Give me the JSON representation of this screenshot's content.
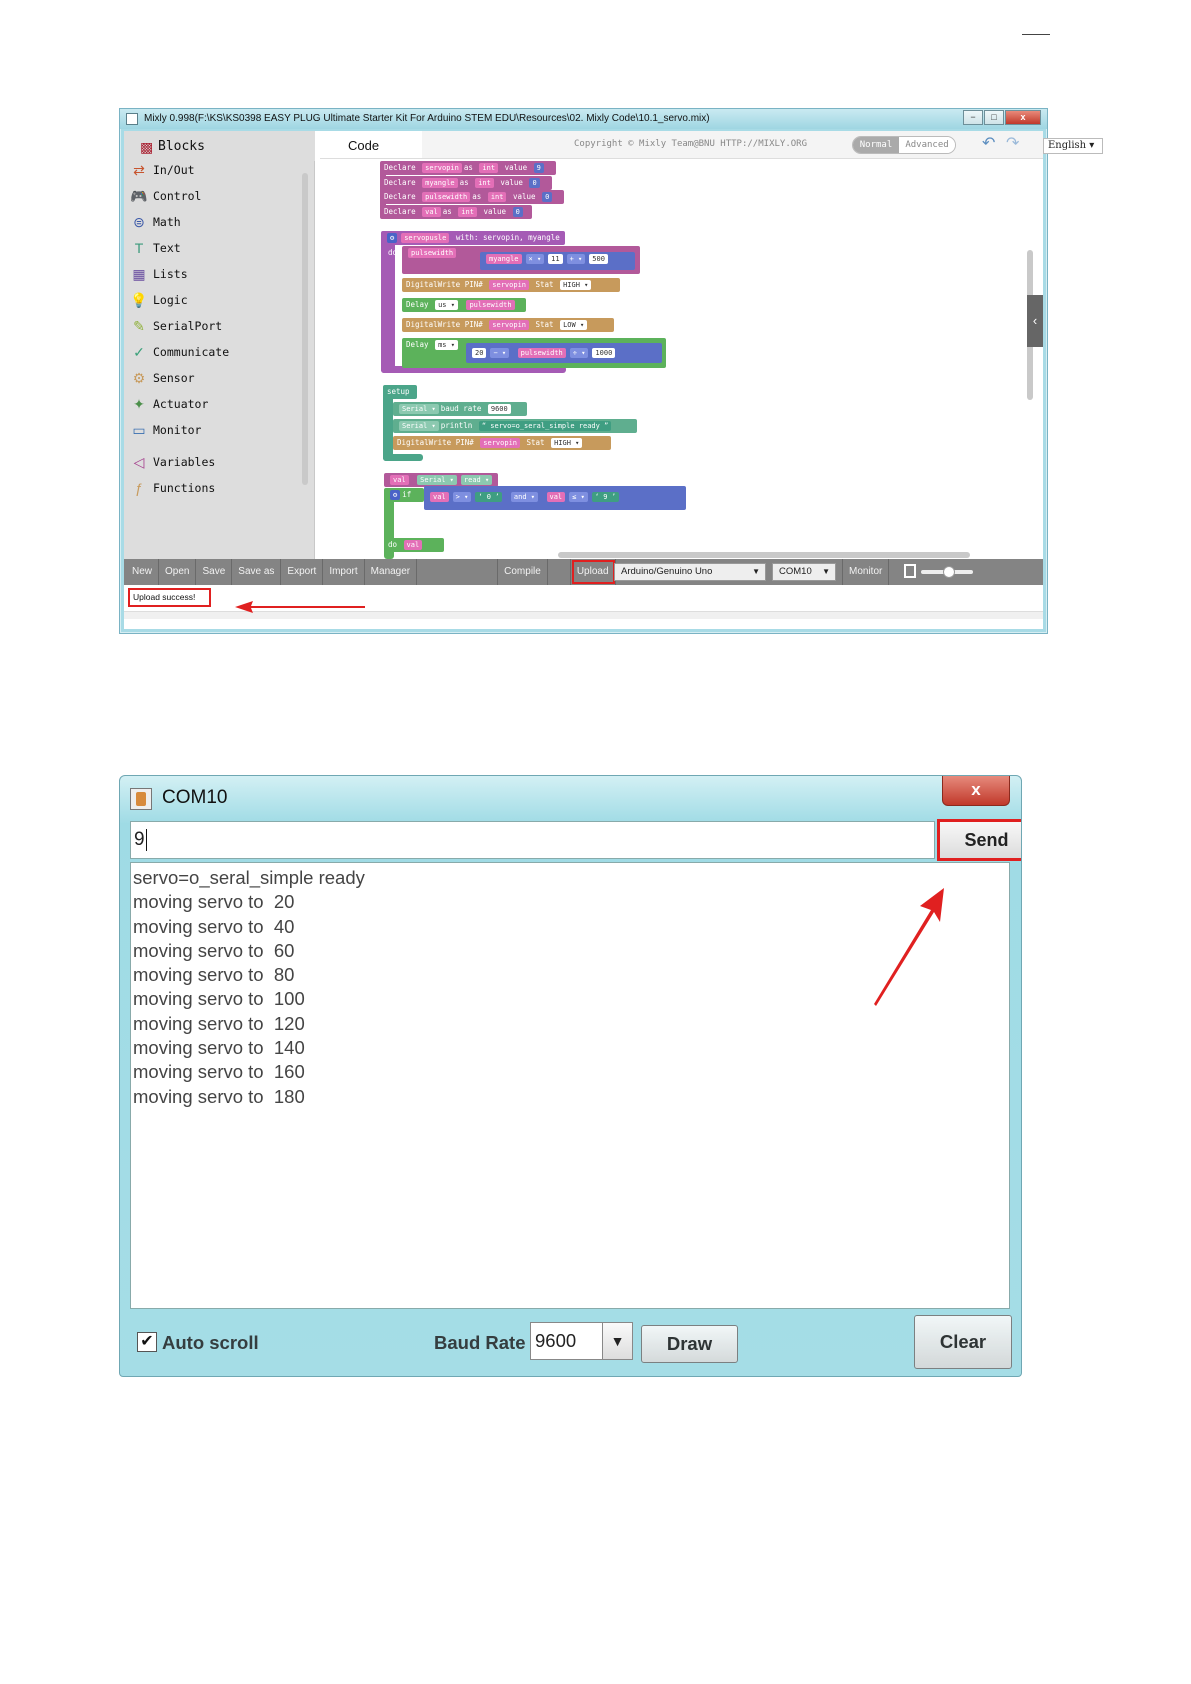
{
  "mixly": {
    "title": "Mixly 0.998(F:\\KS\\KS0398 EASY PLUG Ultimate Starter Kit For Arduino STEM EDU\\Resources\\02. Mixly Code\\10.1_servo.mix)",
    "window_buttons": {
      "minimize": "−",
      "maximize": "□",
      "close": "x"
    },
    "sidebar": {
      "header": "Blocks",
      "categories": [
        {
          "label": "In/Out",
          "icon": "io-arrows-icon",
          "color": "#c7542e"
        },
        {
          "label": "Control",
          "icon": "gamepad-icon",
          "color": "#4b8f4a"
        },
        {
          "label": "Math",
          "icon": "math-icon",
          "color": "#3a58a8"
        },
        {
          "label": "Text",
          "icon": "text-t-icon",
          "color": "#3a9a7b"
        },
        {
          "label": "Lists",
          "icon": "lists-icon",
          "color": "#6a4fa0"
        },
        {
          "label": "Logic",
          "icon": "bulb-icon",
          "color": "#4b6fb0"
        },
        {
          "label": "SerialPort",
          "icon": "pen-icon",
          "color": "#8fb13a"
        },
        {
          "label": "Communicate",
          "icon": "communicate-icon",
          "color": "#3aa17a"
        },
        {
          "label": "Sensor",
          "icon": "sensor-icon",
          "color": "#c79a5c"
        },
        {
          "label": "Actuator",
          "icon": "actuator-icon",
          "color": "#4b8f4a"
        },
        {
          "label": "Monitor",
          "icon": "monitor-icon",
          "color": "#3a6fb0"
        },
        {
          "label": "Variables",
          "icon": "variables-icon",
          "color": "#a23a8a"
        },
        {
          "label": "Functions",
          "icon": "functions-icon",
          "color": "#c79a5c"
        }
      ]
    },
    "header": {
      "tab_code": "Code",
      "copyright": "Copyright © Mixly Team@BNU HTTP://MIXLY.ORG",
      "mode_normal": "Normal",
      "mode_advanced": "Advanced",
      "language": "English ▾"
    },
    "blocks": {
      "declares": [
        {
          "kw": "Declare",
          "var": "servopin",
          "as": "as",
          "type": "int",
          "value_kw": "value",
          "value": "9"
        },
        {
          "kw": "Declare",
          "var": "myangle",
          "as": "as",
          "type": "int",
          "value_kw": "value",
          "value": "0"
        },
        {
          "kw": "Declare",
          "var": "pulsewidth",
          "as": "as",
          "type": "int",
          "value_kw": "value",
          "value": "0"
        },
        {
          "kw": "Declare",
          "var": "val",
          "as": "as",
          "type": "int",
          "value_kw": "value",
          "value": "0"
        }
      ],
      "func_header": "servopusle",
      "func_with": "with: servopin, myangle",
      "do": "do",
      "pulsewidth": "pulsewidth",
      "myangle": "myangle",
      "mul": "× ▾",
      "num11": "11",
      "plus": "+ ▾",
      "num500": "500",
      "digitalwrite": "DigitalWrite PIN#",
      "servopin": "servopin",
      "stat": "Stat",
      "high": "HIGH ▾",
      "low": "LOW ▾",
      "delay": "Delay",
      "us": "us ▾",
      "ms": "ms ▾",
      "num20": "20",
      "minus": "− ▾",
      "div": "÷ ▾",
      "num1000": "1000",
      "setup": "setup",
      "serial": "Serial ▾",
      "baud_rate": "baud rate",
      "num9600": "9600",
      "println": "println",
      "ready_str": "servo=o_seral_simple ready",
      "quote_open": "“",
      "quote_close": "”",
      "val": "val",
      "read": "read ▾",
      "if": "if",
      "gt": "> ▾",
      "q0": "‘ 0 ’",
      "and": "and ▾",
      "le": "≤ ▾",
      "q9": "‘ 9 ’"
    },
    "toolbar": {
      "buttons": [
        "New",
        "Open",
        "Save",
        "Save as",
        "Export",
        "Import",
        "Manager"
      ],
      "compile": "Compile",
      "upload": "Upload",
      "board": "Arduino/Genuino Uno",
      "port": "COM10",
      "monitor": "Monitor"
    },
    "status": "Upload success!"
  },
  "serial_monitor": {
    "title": "COM10",
    "close": "x",
    "input_value": "9",
    "send": "Send",
    "output": [
      "servo=o_seral_simple ready",
      "moving servo to  20",
      "moving servo to  40",
      "moving servo to  60",
      "moving servo to  80",
      "moving servo to  100",
      "moving servo to  120",
      "moving servo to  140",
      "moving servo to  160",
      "moving servo to  180"
    ],
    "auto_scroll_checked": true,
    "check_mark": "✔",
    "auto_scroll": "Auto scroll",
    "baud_label": "Baud Rate",
    "baud_value": "9600",
    "baud_dropdown": "▼",
    "draw": "Draw",
    "clear": "Clear"
  },
  "colors": {
    "highlight": "#e02020",
    "arrow": "#e02020",
    "window_frame": "#a8dbe6"
  }
}
